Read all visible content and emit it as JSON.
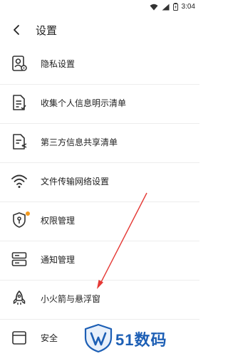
{
  "status_bar": {
    "time": "3:04"
  },
  "header": {
    "title": "设置"
  },
  "menu": {
    "items": [
      {
        "label": "隐私设置",
        "icon": "privacy-profile-icon"
      },
      {
        "label": "收集个人信息明示清单",
        "icon": "document-list-icon"
      },
      {
        "label": "第三方信息共享清单",
        "icon": "document-share-icon"
      },
      {
        "label": "文件传输网络设置",
        "icon": "wifi-icon"
      },
      {
        "label": "权限管理",
        "icon": "permission-shield-icon",
        "badge": true
      },
      {
        "label": "通知管理",
        "icon": "notification-panel-icon"
      },
      {
        "label": "小火箭与悬浮窗",
        "icon": "rocket-icon"
      },
      {
        "label": "安全",
        "icon": "security-icon"
      }
    ]
  },
  "watermark": {
    "text": "51数码"
  },
  "colors": {
    "badge": "#f39a1e",
    "watermark": "#1d5fb5",
    "arrow": "#e53935"
  }
}
